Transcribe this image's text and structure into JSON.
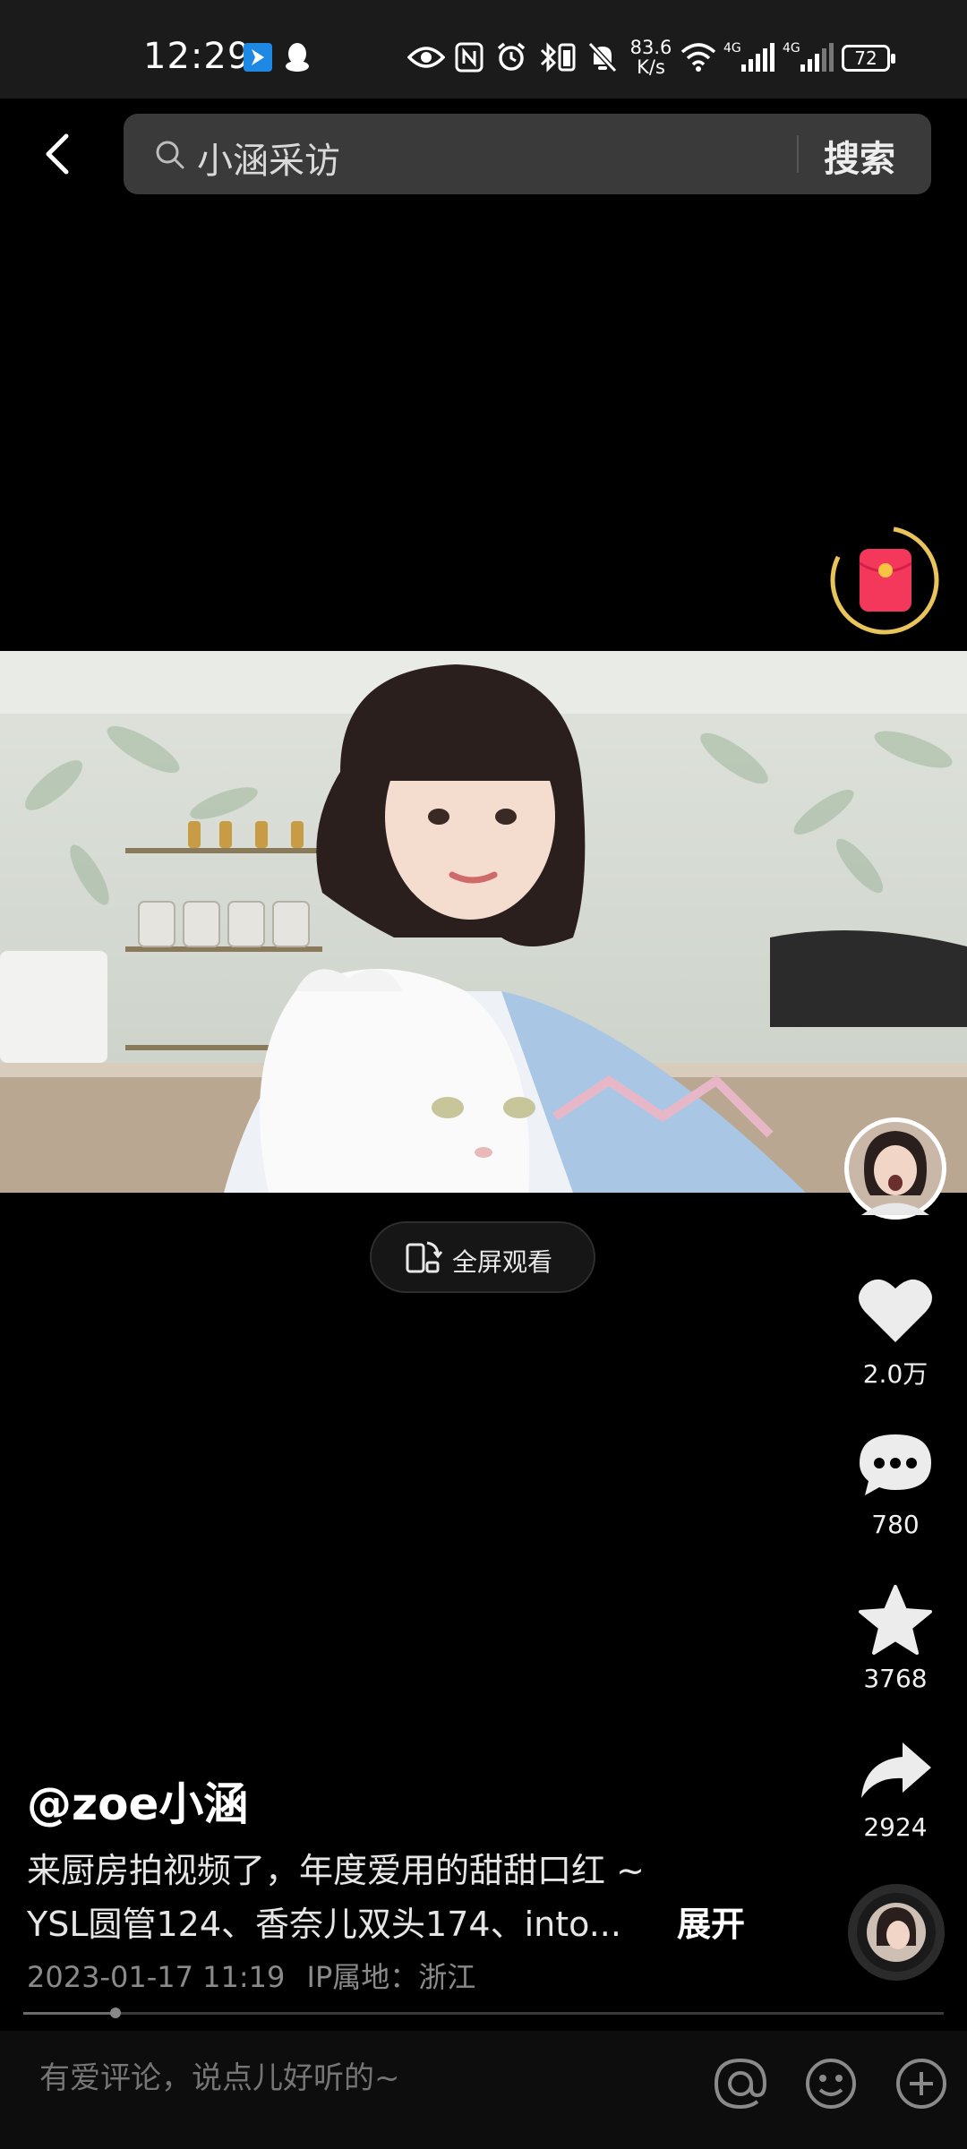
{
  "status_bar": {
    "time": "12:29",
    "network_speed_value": "83.6",
    "network_speed_unit": "K/s",
    "signal_1_label": "4G",
    "signal_2_label": "4G",
    "battery": "72"
  },
  "header": {
    "search_query": "小涵采访",
    "search_button": "搜索"
  },
  "video": {
    "fullscreen_label": "全屏观看"
  },
  "actions": {
    "likes": "2.0万",
    "comments": "780",
    "favorites": "3768",
    "shares": "2924"
  },
  "post": {
    "author": "@zoe小涵",
    "description_line1": "来厨房拍视频了，年度爱用的甜甜口红 ~",
    "description_line2": "YSL圆管124、香奈儿双头174、into...",
    "expand_label": "展开",
    "date": "2023-01-17 11:19",
    "ip_location": "IP属地：浙江",
    "progress": 0.1
  },
  "bottom_bar": {
    "comment_placeholder": "有爱评论，说点儿好听的~"
  },
  "colors": {
    "accent_pink": "#f3385c",
    "gold_ring": "#e8c45a",
    "background": "#000000"
  }
}
